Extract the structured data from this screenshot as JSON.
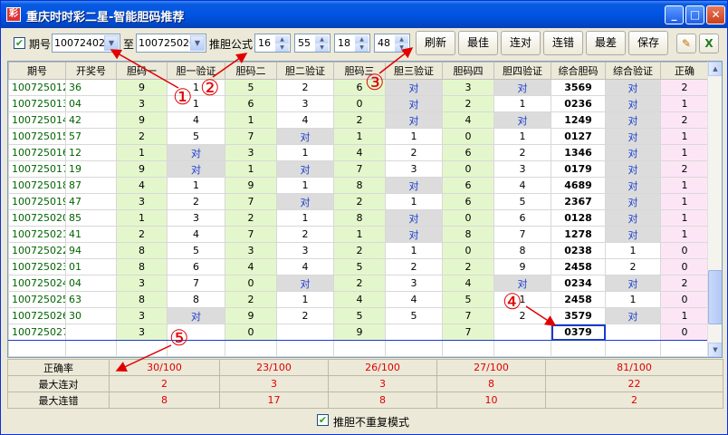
{
  "window": {
    "title": "重庆时时彩二星-智能胆码推荐",
    "icon_name": "app-icon",
    "controls": [
      "minimize-icon",
      "maximize-icon",
      "close-icon"
    ]
  },
  "toolbar": {
    "period_checkbox_checked": true,
    "period_label": "期号",
    "period_from": "100724027",
    "to_label": "至",
    "period_to": "100725026",
    "formula_label": "推胆公式",
    "spin1": "16",
    "spin2": "55",
    "spin3": "18",
    "spin4": "48",
    "buttons": [
      "刷新",
      "最佳",
      "连对",
      "连错",
      "最差",
      "保存"
    ],
    "tool_icons": [
      "broom-icon",
      "excel-icon"
    ]
  },
  "columns": [
    "期号",
    "开奖号",
    "胆码一",
    "胆一验证",
    "胆码二",
    "胆二验证",
    "胆码三",
    "胆三验证",
    "胆码四",
    "胆四验证",
    "综合胆码",
    "综合验证",
    "正确"
  ],
  "rows": [
    [
      "100725012",
      "36",
      "9",
      "1",
      "5",
      "2",
      "6",
      "对",
      "3",
      "对",
      "3569",
      "对",
      "2"
    ],
    [
      "100725013",
      "04",
      "3",
      "1",
      "6",
      "3",
      "0",
      "对",
      "2",
      "1",
      "0236",
      "对",
      "1"
    ],
    [
      "100725014",
      "42",
      "9",
      "4",
      "1",
      "4",
      "2",
      "对",
      "4",
      "对",
      "1249",
      "对",
      "2"
    ],
    [
      "100725015",
      "57",
      "2",
      "5",
      "7",
      "对",
      "1",
      "1",
      "0",
      "1",
      "0127",
      "对",
      "1"
    ],
    [
      "100725016",
      "12",
      "1",
      "对",
      "3",
      "1",
      "4",
      "2",
      "6",
      "2",
      "1346",
      "对",
      "1"
    ],
    [
      "100725017",
      "19",
      "9",
      "对",
      "1",
      "对",
      "7",
      "3",
      "0",
      "3",
      "0179",
      "对",
      "2"
    ],
    [
      "100725018",
      "87",
      "4",
      "1",
      "9",
      "1",
      "8",
      "对",
      "6",
      "4",
      "4689",
      "对",
      "1"
    ],
    [
      "100725019",
      "47",
      "3",
      "2",
      "7",
      "对",
      "2",
      "1",
      "6",
      "5",
      "2367",
      "对",
      "1"
    ],
    [
      "100725020",
      "85",
      "1",
      "3",
      "2",
      "1",
      "8",
      "对",
      "0",
      "6",
      "0128",
      "对",
      "1"
    ],
    [
      "100725021",
      "41",
      "2",
      "4",
      "7",
      "2",
      "1",
      "对",
      "8",
      "7",
      "1278",
      "对",
      "1"
    ],
    [
      "100725022",
      "94",
      "8",
      "5",
      "3",
      "3",
      "2",
      "1",
      "0",
      "8",
      "0238",
      "1",
      "0"
    ],
    [
      "100725023",
      "01",
      "8",
      "6",
      "4",
      "4",
      "5",
      "2",
      "2",
      "9",
      "2458",
      "2",
      "0"
    ],
    [
      "100725024",
      "04",
      "3",
      "7",
      "0",
      "对",
      "2",
      "3",
      "4",
      "对",
      "0234",
      "对",
      "2"
    ],
    [
      "100725025",
      "63",
      "8",
      "8",
      "2",
      "1",
      "4",
      "4",
      "5",
      "1",
      "2458",
      "1",
      "0"
    ],
    [
      "100725026",
      "30",
      "3",
      "对",
      "9",
      "2",
      "5",
      "5",
      "7",
      "2",
      "3579",
      "对",
      "1"
    ],
    [
      "100725027",
      "",
      "3",
      "",
      "0",
      "",
      "9",
      "",
      "7",
      "",
      "0379",
      "",
      "0"
    ]
  ],
  "stats": {
    "accuracy_label": "正确率",
    "max_correct_label": "最大连对",
    "max_wrong_label": "最大连错",
    "accuracy": [
      "30/100",
      "23/100",
      "26/100",
      "27/100",
      "81/100"
    ],
    "max_correct": [
      "2",
      "3",
      "3",
      "8",
      "22"
    ],
    "max_wrong": [
      "8",
      "17",
      "8",
      "10",
      "2"
    ]
  },
  "footer": {
    "checkbox_checked": true,
    "label": "推胆不重复模式"
  },
  "callouts": [
    "①",
    "②",
    "③",
    "④",
    "⑤"
  ],
  "colors": {
    "titlebar": "#0054e3",
    "green_column": "#e4f7cc",
    "pink_column": "#fce6f5",
    "red_text": "#e00000",
    "blue_text": "#1a3ccf",
    "period_text": "#006400"
  }
}
